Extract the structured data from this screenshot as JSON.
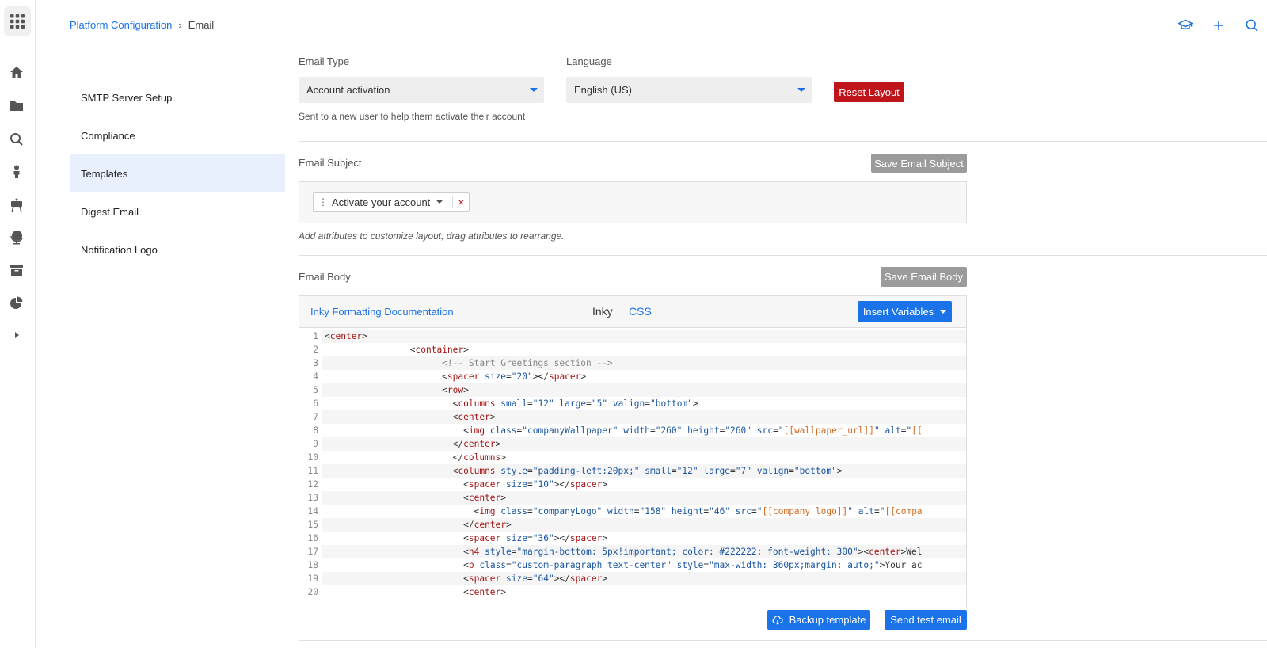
{
  "breadcrumb": {
    "parent": "Platform Configuration",
    "separator": "›",
    "current": "Email"
  },
  "side_menu": {
    "items": [
      {
        "label": "SMTP Server Setup",
        "active": false
      },
      {
        "label": "Compliance",
        "active": false
      },
      {
        "label": "Templates",
        "active": true
      },
      {
        "label": "Digest Email",
        "active": false
      },
      {
        "label": "Notification Logo",
        "active": false
      }
    ]
  },
  "email_type": {
    "label": "Email Type",
    "value": "Account activation",
    "hint": "Sent to a new user to help them activate their account"
  },
  "language": {
    "label": "Language",
    "value": "English (US)"
  },
  "reset_button": "Reset Layout",
  "subject": {
    "label": "Email Subject",
    "save_button": "Save Email Subject",
    "chip": "Activate your account",
    "chip_remove": "×",
    "hint": "Add attributes to customize layout, drag attributes to rearrange."
  },
  "body": {
    "label": "Email Body",
    "save_button": "Save Email Body",
    "doc_link": "Inky Formatting Documentation",
    "tab_inky": "Inky",
    "tab_css": "CSS",
    "insert_button": "Insert Variables",
    "backup_button": "Backup template",
    "test_button": "Send test email",
    "line_numbers": [
      "1",
      "2",
      "3",
      "4",
      "5",
      "6",
      "7",
      "8",
      "9",
      "10",
      "11",
      "12",
      "13",
      "14",
      "15",
      "16",
      "17",
      "18",
      "19",
      "20"
    ]
  },
  "colors": {
    "accent": "#1a73e8",
    "danger": "#c0141b",
    "muted_button": "#9b9b9b",
    "active_menu": "#e8effd"
  },
  "icons": [
    "apps-grid-icon",
    "home-icon",
    "folder-icon",
    "search-icon",
    "person-icon",
    "presentation-icon",
    "globe-icon",
    "archive-icon",
    "pie-chart-icon",
    "expand-arrow-icon",
    "graduation-cap-icon",
    "plus-icon",
    "search-icon"
  ]
}
